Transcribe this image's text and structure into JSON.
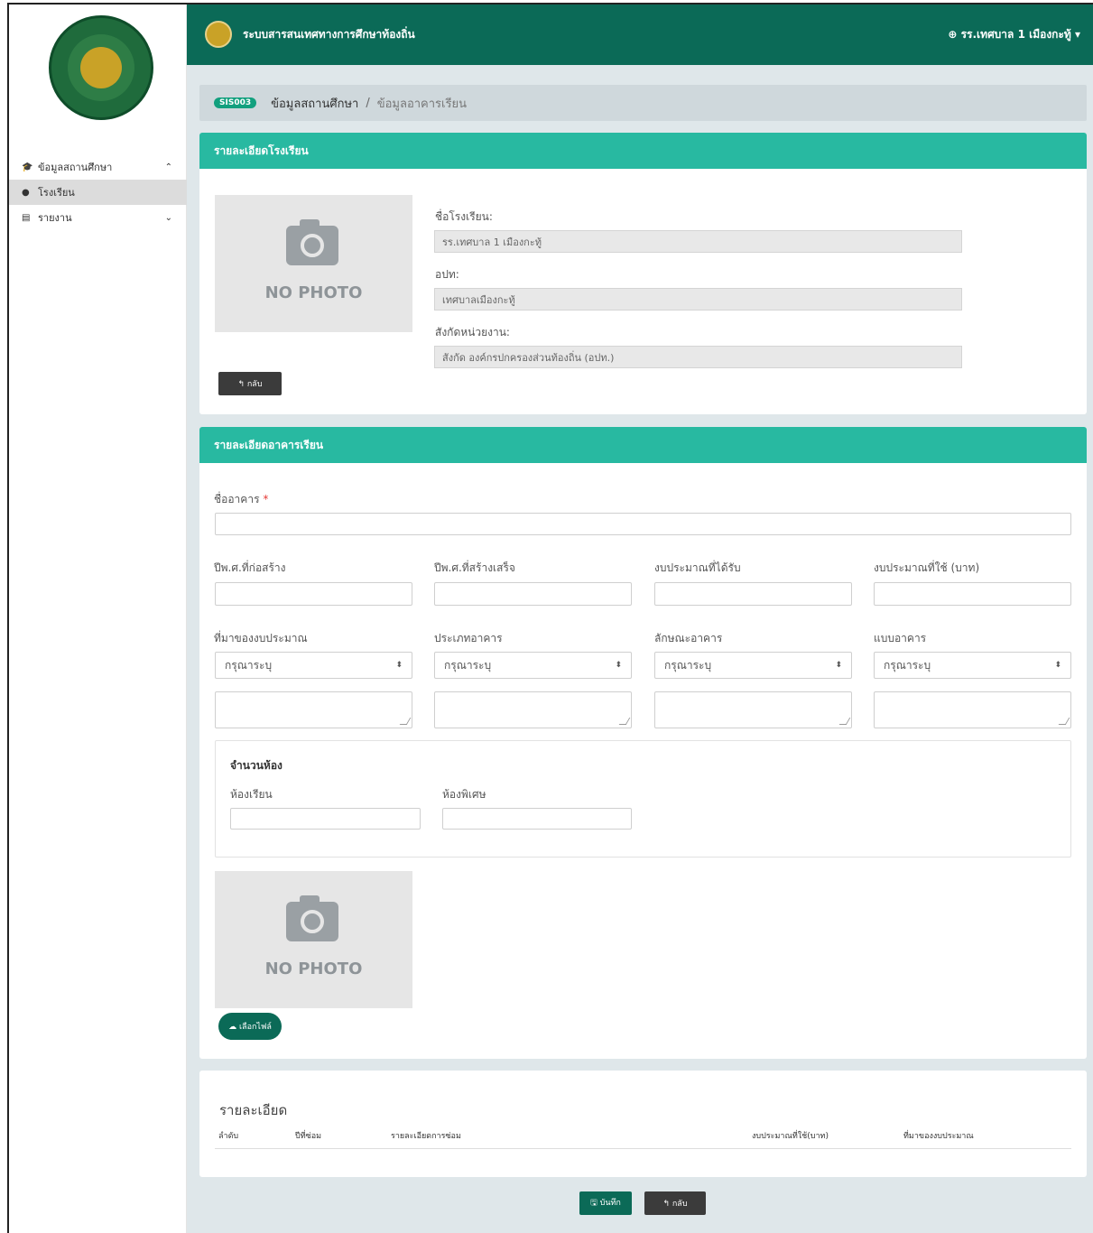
{
  "topbar": {
    "app_title": "ระบบสารสนเทศทางการศึกษาท้องถิ่น",
    "user_label": "⊕ รร.เทศบาล 1 เมืองกะทู้ ▾"
  },
  "sidebar": {
    "items": [
      {
        "label": "ข้อมูลสถานศึกษา",
        "icon": "graduation-cap-icon"
      },
      {
        "label": "โรงเรียน",
        "icon": "dot-icon"
      },
      {
        "label": "รายงาน",
        "icon": "file-icon"
      }
    ]
  },
  "breadcrumb": {
    "badge": "SIS003",
    "current": "ข้อมูลสถานศึกษา",
    "separator": "/",
    "last": "ข้อมูลอาคารเรียน"
  },
  "school_card": {
    "title": "รายละเอียดโรงเรียน",
    "photo_text": "NO PHOTO",
    "back_label": "↰ กลับ",
    "fields": [
      {
        "label": "ชื่อโรงเรียน:",
        "value": "รร.เทศบาล 1 เมืองกะทู้"
      },
      {
        "label": "อปท:",
        "value": "เทศบาลเมืองกะทู้"
      },
      {
        "label": "สังกัดหน่วยงาน:",
        "value": "สังกัด องค์กรปกครองส่วนท้องถิ่น (อปท.)"
      }
    ]
  },
  "building_card": {
    "title": "รายละเอียดอาคารเรียน",
    "name_label": "ชื่ออาคาร",
    "required_mark": "*",
    "row1_labels": [
      "ปีพ.ศ.ที่ก่อสร้าง",
      "ปีพ.ศ.ที่สร้างเสร็จ",
      "งบประมาณที่ได้รับ",
      "งบประมาณที่ใช้ (บาท)"
    ],
    "row2_labels": [
      "ที่มาของงบประมาณ",
      "ประเภทอาคาร",
      "ลักษณะอาคาร",
      "แบบอาคาร"
    ],
    "select_placeholder": "กรุณาระบุ",
    "rooms_title": "จำนวนห้อง",
    "rooms_labels": [
      "ห้องเรียน",
      "ห้องพิเศษ"
    ],
    "photo_text": "NO PHOTO",
    "choose_file_label": "☁ เลือกไฟล์"
  },
  "detail_card": {
    "title": "รายละเอียด",
    "columns": [
      "ลำดับ",
      "ปีที่ซ่อม",
      "รายละเอียดการซ่อม",
      "งบประมาณที่ใช้(บาท)",
      "ที่มาของงบประมาณ"
    ]
  },
  "footer": {
    "save_label": "🖫 บันทึก",
    "back_label": "↰ กลับ"
  }
}
